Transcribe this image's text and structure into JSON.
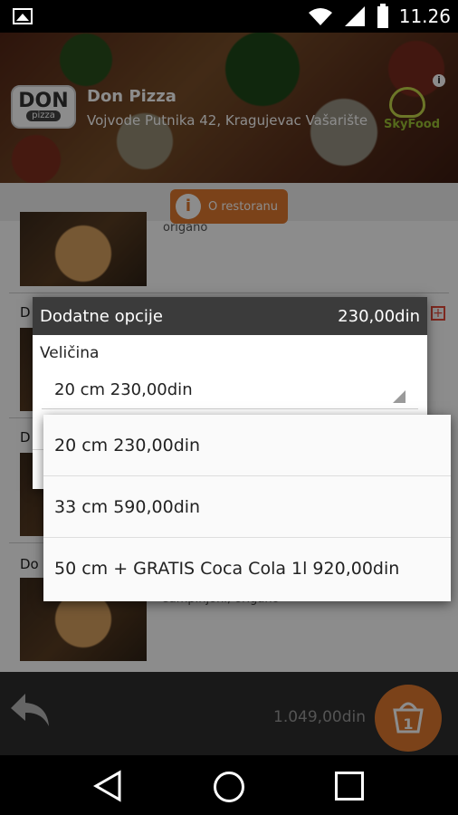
{
  "status_bar": {
    "time": "11.26",
    "icons": [
      "image-icon",
      "wifi-icon",
      "signal-icon",
      "battery-icon"
    ]
  },
  "restaurant": {
    "logo_top": "DON",
    "logo_bottom": "pizza",
    "name": "Don Pizza",
    "address": "Vojvode Putnika 42, Kragujevac Vašarište",
    "partner_logo": "SkyFood",
    "about_label": "O restoranu"
  },
  "list": {
    "items": [
      {
        "title": "",
        "desc": "origano"
      },
      {
        "title": "D",
        "desc": ""
      },
      {
        "title": "D",
        "desc": ""
      },
      {
        "title": "Do",
        "desc": "šampinjoni, origano"
      }
    ]
  },
  "dialog": {
    "title": "Dodatne opcije",
    "price": "230,00din",
    "section_label": "Veličina",
    "selected_value": "20 cm 230,00din"
  },
  "dropdown": {
    "options": [
      "20 cm 230,00din",
      "33 cm 590,00din",
      "50 cm + GRATIS Coca Cola 1l  920,00din"
    ]
  },
  "bottom_bar": {
    "total": "1.049,00din",
    "basket_count": "1"
  },
  "colors": {
    "accent": "#e1792f",
    "dialog_header": "#3b3b3b",
    "add_icon": "#e64a3a"
  }
}
